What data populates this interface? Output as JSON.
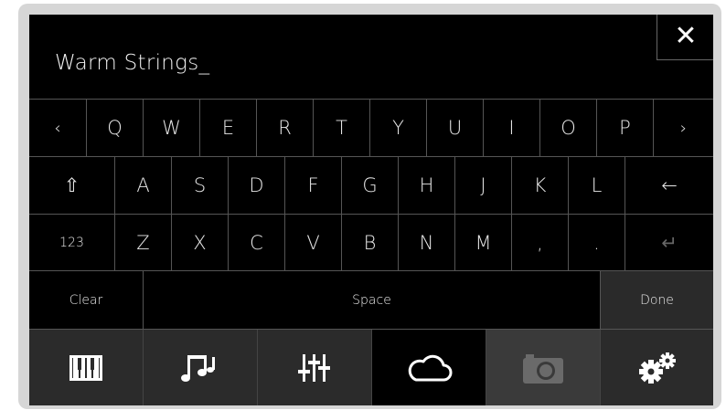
{
  "text_field": {
    "value": "Warm Strings_"
  },
  "close_label": "✕",
  "keyboard": {
    "row1": [
      "‹",
      "Q",
      "W",
      "E",
      "R",
      "T",
      "Y",
      "U",
      "I",
      "O",
      "P",
      "›"
    ],
    "row2": [
      "⇧",
      "A",
      "S",
      "D",
      "F",
      "G",
      "H",
      "J",
      "K",
      "L",
      "←"
    ],
    "row3": [
      "123",
      "Z",
      "X",
      "C",
      "V",
      "B",
      "N",
      "M",
      ",",
      ".",
      "↵"
    ],
    "clear_label": "Clear",
    "space_label": "Space",
    "done_label": "Done"
  },
  "tabbar": [
    {
      "icon": "piano-keys-icon",
      "state": "normal"
    },
    {
      "icon": "music-notes-icon",
      "state": "normal"
    },
    {
      "icon": "mixer-sliders-icon",
      "state": "normal"
    },
    {
      "icon": "cloud-icon",
      "state": "active"
    },
    {
      "icon": "camera-icon",
      "state": "disabled"
    },
    {
      "icon": "gears-icon",
      "state": "normal"
    }
  ],
  "colors": {
    "screen_bg": "#000000",
    "bezel": "#d6d6d6",
    "tab_bg": "#2b2b2b",
    "key_text": "#e8e8e8"
  }
}
